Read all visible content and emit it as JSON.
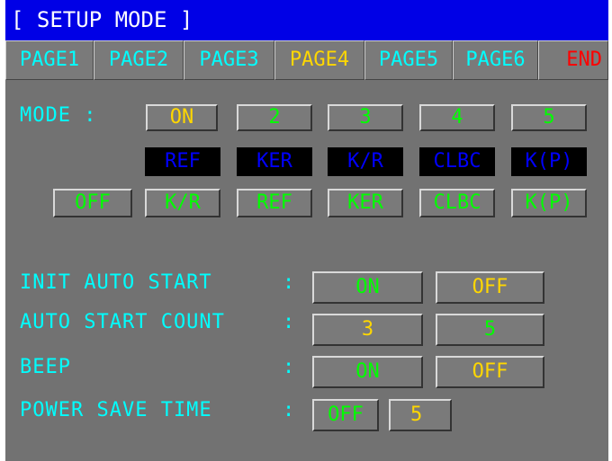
{
  "title": "[ SETUP MODE ]",
  "tabs": [
    "PAGE1",
    "PAGE2",
    "PAGE3",
    "PAGE4",
    "PAGE5",
    "PAGE6",
    "END"
  ],
  "active_tab": "PAGE4",
  "mode": {
    "label": "MODE :",
    "numbers": [
      "ON",
      "2",
      "3",
      "4",
      "5"
    ],
    "ref_row": [
      "REF",
      "KER",
      "K/R",
      "CLBC",
      "K(P)"
    ],
    "sel_off": "OFF",
    "sel_row": [
      "K/R",
      "REF",
      "KER",
      "CLBC",
      "K(P)"
    ]
  },
  "settings": [
    {
      "label": "INIT AUTO START",
      "colon": ":",
      "opt1": "ON",
      "opt2": "OFF"
    },
    {
      "label": "AUTO START COUNT",
      "colon": ":",
      "opt1": "3",
      "opt2": "5"
    },
    {
      "label": "BEEP",
      "colon": ":",
      "opt1": "ON",
      "opt2": "OFF"
    },
    {
      "label": "POWER SAVE TIME",
      "colon": ":",
      "opt1": "OFF",
      "opt2": "5"
    }
  ],
  "colors": {
    "background": "#727272",
    "title_bar": "#0000e6",
    "label": "#00ffff",
    "active": "#ffd700",
    "selected": "#00ff00",
    "end": "#ff0000",
    "ref_text": "#0000ff"
  }
}
